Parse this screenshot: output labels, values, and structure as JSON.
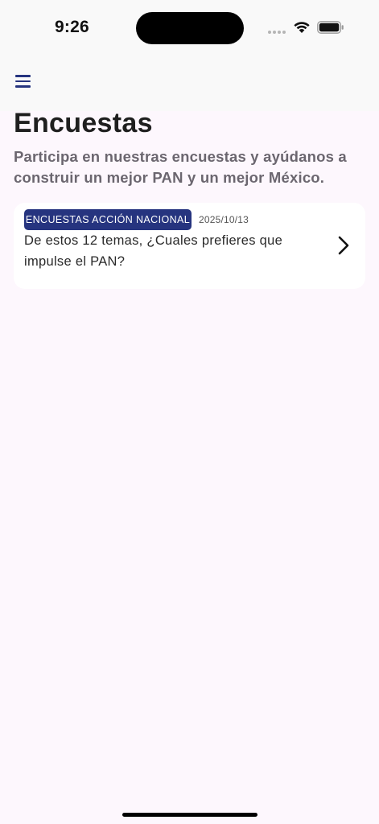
{
  "status_bar": {
    "time": "9:26"
  },
  "app_bar": {
    "menu_icon": "hamburger-menu-icon",
    "accent_color": "#26347f"
  },
  "page": {
    "title": "Encuestas",
    "subtitle": "Participa en nuestras encuestas y ayúdanos a construir un mejor PAN y un mejor México."
  },
  "surveys": [
    {
      "category": "ENCUESTAS ACCIÓN NACIONAL",
      "date": "2025/10/13",
      "question": "De estos 12 temas, ¿Cuales prefieres que impulse el PAN?",
      "icon": "chevron-right-icon"
    }
  ],
  "colors": {
    "background": "#fdf7fd",
    "badge": "#26347f",
    "card": "#ffffff"
  }
}
